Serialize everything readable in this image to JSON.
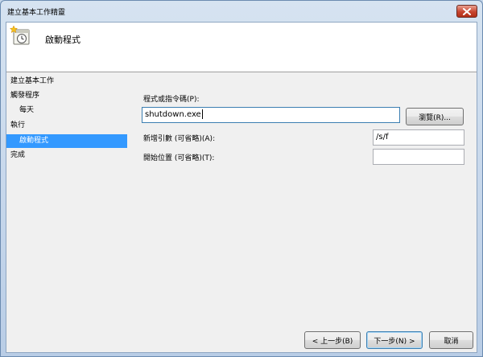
{
  "window": {
    "title": "建立基本工作精靈"
  },
  "header": {
    "title": "啟動程式",
    "icon": "task-scheduler-wizard-icon"
  },
  "nav": {
    "items": [
      {
        "label": "建立基本工作",
        "level": 0,
        "selected": false
      },
      {
        "label": "觸發程序",
        "level": 0,
        "selected": false
      },
      {
        "label": "每天",
        "level": 1,
        "selected": false
      },
      {
        "label": "執行",
        "level": 0,
        "selected": false
      },
      {
        "label": "啟動程式",
        "level": 1,
        "selected": true
      },
      {
        "label": "完成",
        "level": 0,
        "selected": false
      }
    ]
  },
  "form": {
    "program_label": "程式或指令碼(P):",
    "program_value": "shutdown.exe",
    "browse_label": "瀏覽(R)...",
    "args_label": "新增引數 (可省略)(A):",
    "args_value": "/s/f",
    "start_in_label": "開始位置 (可省略)(T):",
    "start_in_value": ""
  },
  "buttons": {
    "back": "< 上一步(B)",
    "next": "下一步(N) >",
    "cancel": "取消"
  },
  "colors": {
    "selection": "#3399ff",
    "close_button": "#c7452f"
  }
}
